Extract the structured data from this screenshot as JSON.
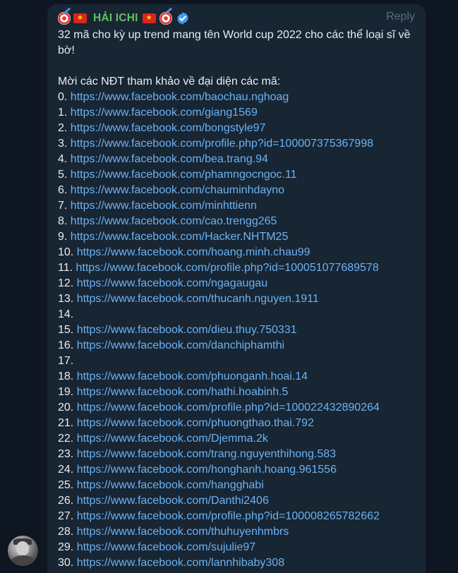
{
  "message": {
    "sender_name": "HẢI ICHI",
    "reply_label": "Reply",
    "intro": "32 mã cho kỳ up trend mang tên World cup 2022 cho các thể loại sĩ về bờ!",
    "subtitle": "Mời các NĐT tham khảo về đại diện các mã:",
    "entries": [
      {
        "num": "0.",
        "url": "https://www.facebook.com/baochau.nghoag"
      },
      {
        "num": "1.",
        "url": "https://www.facebook.com/giang1569"
      },
      {
        "num": "2.",
        "url": "https://www.facebook.com/bongstyle97"
      },
      {
        "num": "3.",
        "url": "https://www.facebook.com/profile.php?id=100007375367998"
      },
      {
        "num": "4.",
        "url": "https://www.facebook.com/bea.trang.94"
      },
      {
        "num": "5.",
        "url": "https://www.facebook.com/phamngocngoc.11"
      },
      {
        "num": "6.",
        "url": "https://www.facebook.com/chauminhdayno"
      },
      {
        "num": "7.",
        "url": "https://www.facebook.com/minhttienn"
      },
      {
        "num": "8.",
        "url": "https://www.facebook.com/cao.trengg265"
      },
      {
        "num": "9.",
        "url": "https://www.facebook.com/Hacker.NHTM25"
      },
      {
        "num": "10.",
        "url": "https://www.facebook.com/hoang.minh.chau99"
      },
      {
        "num": "11.",
        "url": "https://www.facebook.com/profile.php?id=100051077689578"
      },
      {
        "num": "12.",
        "url": "https://www.facebook.com/ngagaugau"
      },
      {
        "num": "13.",
        "url": "https://www.facebook.com/thucanh.nguyen.1911"
      },
      {
        "num": "14.",
        "url": ""
      },
      {
        "num": "15.",
        "url": "https://www.facebook.com/dieu.thuy.750331"
      },
      {
        "num": "16.",
        "url": "https://www.facebook.com/danchiphamthi"
      },
      {
        "num": "17.",
        "url": ""
      },
      {
        "num": "18.",
        "url": "https://www.facebook.com/phuonganh.hoai.14"
      },
      {
        "num": "19.",
        "url": "https://www.facebook.com/hathi.hoabinh.5"
      },
      {
        "num": "20.",
        "url": "https://www.facebook.com/profile.php?id=100022432890264"
      },
      {
        "num": "21.",
        "url": "https://www.facebook.com/phuongthao.thai.792"
      },
      {
        "num": "22.",
        "url": "https://www.facebook.com/Djemma.2k"
      },
      {
        "num": "23.",
        "url": "https://www.facebook.com/trang.nguyenthihong.583"
      },
      {
        "num": "24.",
        "url": "https://www.facebook.com/honghanh.hoang.961556"
      },
      {
        "num": "25.",
        "url": "https://www.facebook.com/hangghabi"
      },
      {
        "num": "26.",
        "url": "https://www.facebook.com/Danthi2406"
      },
      {
        "num": "27.",
        "url": "https://www.facebook.com/profile.php?id=100008265782662"
      },
      {
        "num": "28.",
        "url": "https://www.facebook.com/thuhuyenhmbrs"
      },
      {
        "num": "29.",
        "url": "https://www.facebook.com/sujulie97"
      },
      {
        "num": "30.",
        "url": "https://www.facebook.com/lannhibaby308"
      }
    ]
  },
  "icons": {
    "dart": "direct-hit-dart-icon",
    "flag": "vietnam-flag-icon",
    "verified": "verified-badge-icon",
    "avatar": "sender-avatar"
  },
  "colors": {
    "background": "#0e1621",
    "bubble": "#182533",
    "name": "#61c25f",
    "link": "#6ab3f3",
    "text": "#e9eef3",
    "reply": "#5a6c7e",
    "verified": "#3e9bf0"
  }
}
